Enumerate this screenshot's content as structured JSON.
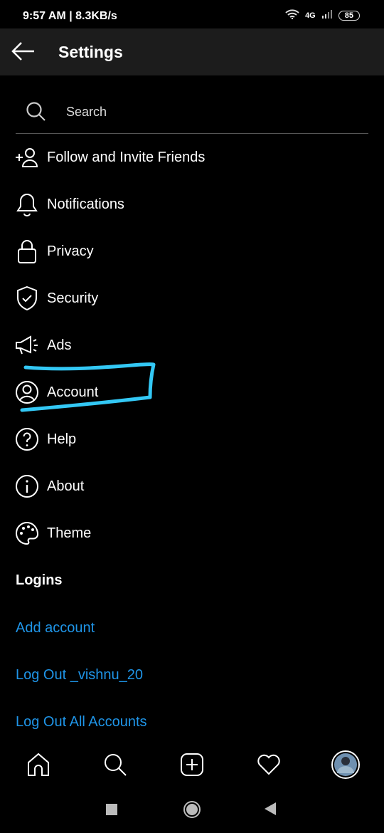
{
  "status_bar": {
    "time": "9:57 AM | 8.3KB/s",
    "network": "4G",
    "battery": "85"
  },
  "header": {
    "title": "Settings"
  },
  "search": {
    "placeholder": "Search"
  },
  "menu": [
    {
      "label": "Follow and Invite Friends",
      "icon": "add-user-icon"
    },
    {
      "label": "Notifications",
      "icon": "bell-icon"
    },
    {
      "label": "Privacy",
      "icon": "lock-icon"
    },
    {
      "label": "Security",
      "icon": "shield-icon"
    },
    {
      "label": "Ads",
      "icon": "megaphone-icon"
    },
    {
      "label": "Account",
      "icon": "account-icon"
    },
    {
      "label": "Help",
      "icon": "help-icon"
    },
    {
      "label": "About",
      "icon": "info-icon"
    },
    {
      "label": "Theme",
      "icon": "palette-icon"
    }
  ],
  "logins": {
    "title": "Logins",
    "add_account": "Add account",
    "log_out": "Log Out _vishnu_20",
    "log_out_all": "Log Out All Accounts"
  },
  "colors": {
    "link": "#1f95e8",
    "header_bg": "#1c1c1c",
    "annotation": "#33c8f5"
  }
}
